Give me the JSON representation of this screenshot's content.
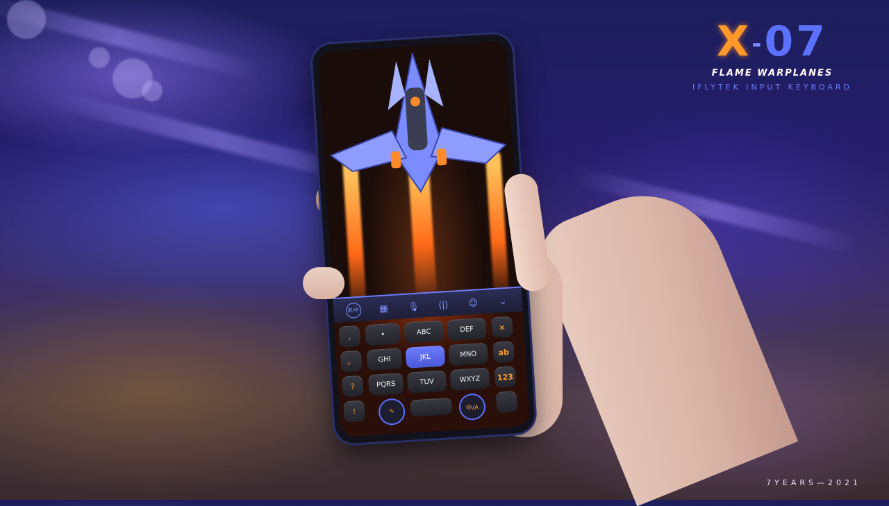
{
  "brand": {
    "logo_x": "X",
    "logo_dash": "-",
    "logo_num": "07",
    "subtitle": "FLAME WARPLANES",
    "subtitle2": "IFLYTEK INPUT KEYBOARD",
    "footer": "7YEARS—2021"
  },
  "keyboard": {
    "toolbar": [
      {
        "name": "language",
        "glyph": "英/中"
      },
      {
        "name": "layout",
        "glyph": "▦"
      },
      {
        "name": "voice",
        "glyph": "🎙"
      },
      {
        "name": "cursor",
        "glyph": "⟨|⟩"
      },
      {
        "name": "emoji",
        "glyph": "☺"
      },
      {
        "name": "collapse",
        "glyph": "⌄"
      }
    ],
    "side_keys": [
      ",",
      "。",
      "?",
      "!"
    ],
    "row1": [
      "ABC",
      "DEF"
    ],
    "row2": [
      "GHI",
      "JKL",
      "MNO"
    ],
    "row3": [
      "PQRS",
      "TUV",
      "WXYZ"
    ],
    "right_keys": [
      "×",
      "ab",
      "123"
    ],
    "bottom": {
      "left": "✎",
      "right": "中/A"
    }
  },
  "colors": {
    "accent": "#5c72ff",
    "flame": "#ff9a2a"
  }
}
